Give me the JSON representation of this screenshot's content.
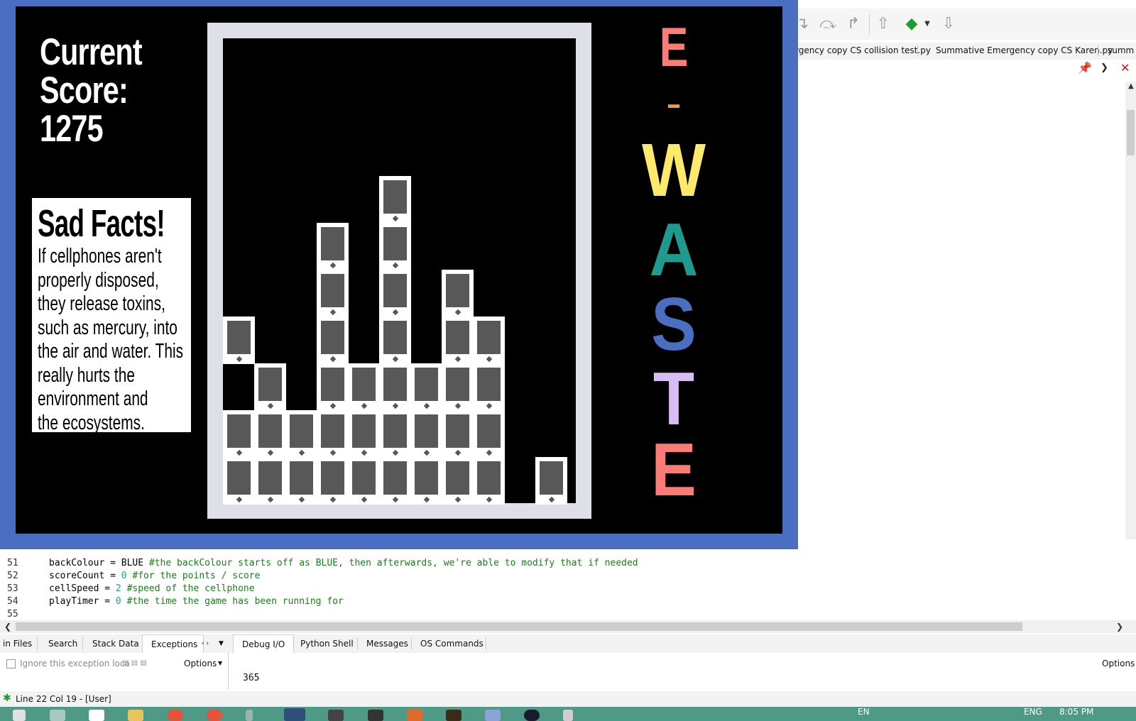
{
  "game": {
    "score_label": "Current Score:",
    "score_value": "1275",
    "facts_title": "Sad Facts!",
    "facts_lines": [
      "If cellphones aren't",
      "properly disposed,",
      "they release toxins,",
      "such as mercury, into",
      "the air and water. This",
      "really hurts the",
      "environment and",
      "the ecosystems."
    ],
    "title_letters": [
      {
        "char": "E",
        "color": "#f97c76"
      },
      {
        "char": "-",
        "color": "#f39c3b"
      },
      {
        "char": "W",
        "color": "#fde96a"
      },
      {
        "char": "A",
        "color": "#1f9a8f"
      },
      {
        "char": "S",
        "color": "#4a6fc2"
      },
      {
        "char": "T",
        "color": "#d7bdf1"
      },
      {
        "char": "E",
        "color": "#f97c76"
      }
    ],
    "board_stacks": [
      {
        "column": 1,
        "filled_rows": [
          1,
          2,
          4
        ]
      },
      {
        "column": 2,
        "filled_rows": [
          1,
          2,
          3
        ]
      },
      {
        "column": 3,
        "filled_rows": [
          1,
          2
        ]
      },
      {
        "column": 4,
        "filled_rows": [
          1,
          2,
          3,
          4,
          5,
          6
        ]
      },
      {
        "column": 5,
        "filled_rows": [
          1,
          2,
          3
        ]
      },
      {
        "column": 6,
        "filled_rows": [
          1,
          2,
          3,
          4,
          5,
          6,
          7
        ]
      },
      {
        "column": 7,
        "filled_rows": [
          1,
          2,
          3
        ]
      },
      {
        "column": 8,
        "filled_rows": [
          1,
          2,
          3,
          4,
          5
        ]
      },
      {
        "column": 9,
        "filled_rows": [
          1,
          2,
          3,
          4
        ]
      },
      {
        "column": 11,
        "filled_rows": [
          1
        ]
      }
    ]
  },
  "ide": {
    "file_tabs": [
      "rgency copy CS collision test.py",
      "Summative Emergency copy CS Karen.py",
      "summ"
    ],
    "code_lines": [
      {
        "num": "51",
        "code": "backColour = BLUE ",
        "comment": "#the backColour starts off as BLUE, then afterwards, we're able to modify that if needed"
      },
      {
        "num": "52",
        "code": "scoreCount = ",
        "value": "0",
        "comment": " #for the points / score"
      },
      {
        "num": "53",
        "code": "cellSpeed = ",
        "value": "2",
        "comment": " #speed of the cellphone"
      },
      {
        "num": "54",
        "code": "playTimer = ",
        "value": "0",
        "comment": " #the time the game has been running for"
      },
      {
        "num": "55",
        "code": ""
      }
    ],
    "left_tabs": [
      "in Files",
      "Search",
      "Stack Data",
      "Exceptions"
    ],
    "right_tabs": [
      "Debug I/O",
      "Python Shell",
      "Messages",
      "OS Commands"
    ],
    "ignore_exception_label": "Ignore this exception loca",
    "options_label": "Options",
    "options_right_label": "Options",
    "debug_output": "365",
    "status_text": "Line 22 Col 19 - [User]",
    "tray": {
      "lang1": "EN",
      "lang2": "ENG",
      "time": "8:05 PM"
    }
  }
}
